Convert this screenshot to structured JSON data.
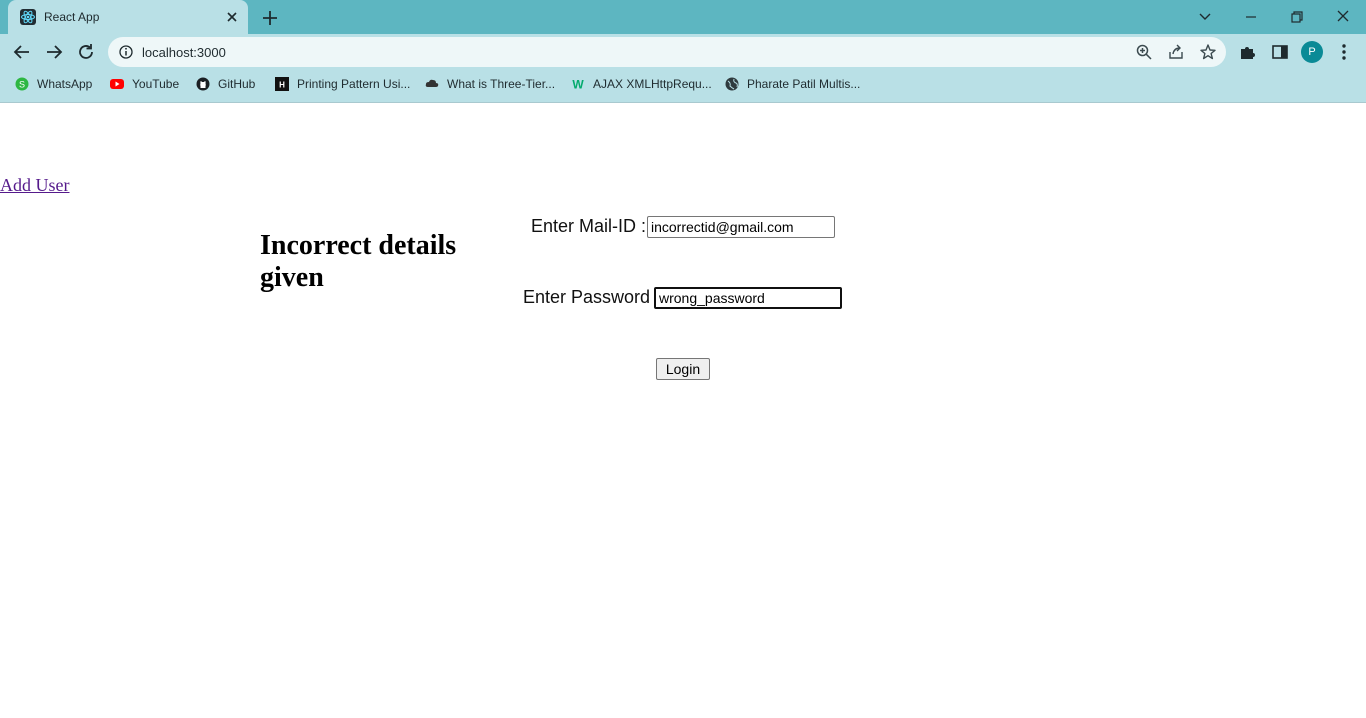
{
  "browser": {
    "tab_title": "React App",
    "url": "localhost:3000",
    "profile_initial": "P",
    "bookmarks": [
      {
        "label": "WhatsApp",
        "icon": "whatsapp-icon"
      },
      {
        "label": "YouTube",
        "icon": "youtube-icon"
      },
      {
        "label": "GitHub",
        "icon": "github-icon"
      },
      {
        "label": "Printing Pattern Usi...",
        "icon": "geeks-icon"
      },
      {
        "label": "What is Three-Tier...",
        "icon": "cloud-icon"
      },
      {
        "label": "AJAX XMLHttpRequ...",
        "icon": "w3schools-icon"
      },
      {
        "label": "Pharate Patil Multis...",
        "icon": "globe-icon"
      }
    ],
    "colors": {
      "tabstrip": "#5db6c1",
      "toolbar": "#b9e0e6",
      "avatar": "#0a8a96"
    }
  },
  "page": {
    "add_user_link": "Add User",
    "error_message": "Incorrect details given",
    "mail_label": "Enter Mail-ID :",
    "mail_value": "incorrectid@gmail.com",
    "password_label": "Enter Password :",
    "password_value": "wrong_password",
    "login_label": "Login",
    "link_color": "#551a8b"
  }
}
